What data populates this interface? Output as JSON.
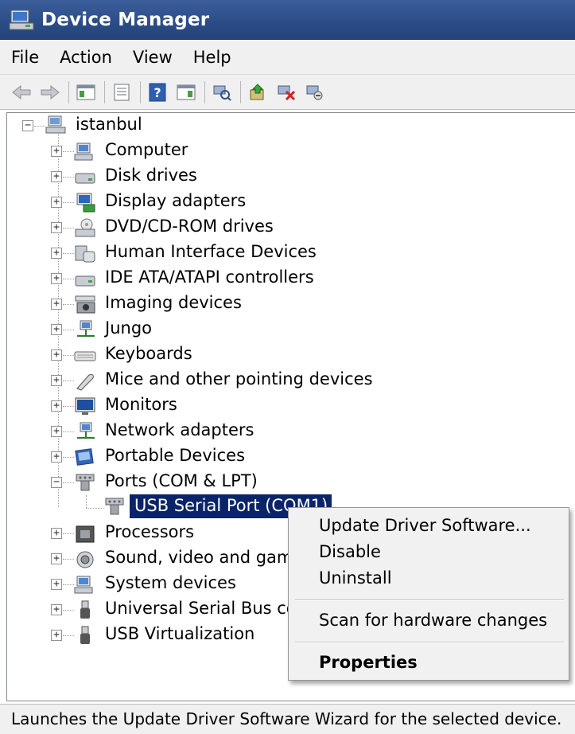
{
  "window": {
    "title": "Device Manager"
  },
  "menubar": {
    "items": [
      "File",
      "Action",
      "View",
      "Help"
    ]
  },
  "toolbar": {
    "buttons": [
      "back-icon",
      "forward-icon",
      "show-hide-console-tree-icon",
      "properties-icon",
      "help-icon",
      "show-action-pane-icon",
      "scan-hardware-icon",
      "update-driver-icon",
      "disable-device-icon",
      "uninstall-device-icon"
    ]
  },
  "tree": {
    "root": {
      "label": "istanbul",
      "icon": "computer-icon",
      "expanded": true
    },
    "categories": [
      {
        "label": "Computer",
        "icon": "computer-icon",
        "expanded": false
      },
      {
        "label": "Disk drives",
        "icon": "disk-drive-icon",
        "expanded": false
      },
      {
        "label": "Display adapters",
        "icon": "display-adapter-icon",
        "expanded": false
      },
      {
        "label": "DVD/CD-ROM drives",
        "icon": "dvd-drive-icon",
        "expanded": false
      },
      {
        "label": "Human Interface Devices",
        "icon": "hid-icon",
        "expanded": false
      },
      {
        "label": "IDE ATA/ATAPI controllers",
        "icon": "ide-controller-icon",
        "expanded": false
      },
      {
        "label": "Imaging devices",
        "icon": "camera-icon",
        "expanded": false
      },
      {
        "label": "Jungo",
        "icon": "network-icon",
        "expanded": false
      },
      {
        "label": "Keyboards",
        "icon": "keyboard-icon",
        "expanded": false
      },
      {
        "label": "Mice and other pointing devices",
        "icon": "mouse-icon",
        "expanded": false
      },
      {
        "label": "Monitors",
        "icon": "monitor-icon",
        "expanded": false
      },
      {
        "label": "Network adapters",
        "icon": "network-icon",
        "expanded": false
      },
      {
        "label": "Portable Devices",
        "icon": "portable-device-icon",
        "expanded": false
      },
      {
        "label": "Ports (COM & LPT)",
        "icon": "port-icon",
        "expanded": true,
        "children": [
          {
            "label": "USB Serial Port (COM1)",
            "icon": "port-icon",
            "selected": true
          }
        ]
      },
      {
        "label": "Processors",
        "icon": "processor-icon",
        "expanded": false
      },
      {
        "label": "Sound, video and game",
        "icon": "sound-icon",
        "expanded": false
      },
      {
        "label": "System devices",
        "icon": "computer-icon",
        "expanded": false
      },
      {
        "label": "Universal Serial Bus cont",
        "icon": "usb-icon",
        "expanded": false
      },
      {
        "label": "USB Virtualization",
        "icon": "usb-icon",
        "expanded": false
      }
    ]
  },
  "context_menu": {
    "items": [
      {
        "label": "Update Driver Software...",
        "bold": false
      },
      {
        "label": "Disable",
        "bold": false
      },
      {
        "label": "Uninstall",
        "bold": false
      },
      {
        "label": "Scan for hardware changes",
        "bold": false
      },
      {
        "label": "Properties",
        "bold": true
      }
    ]
  },
  "statusbar": {
    "text": "Launches the Update Driver Software Wizard for the selected device."
  },
  "colors": {
    "selection": "#0a246a",
    "titlebar": "#2b4c86"
  }
}
